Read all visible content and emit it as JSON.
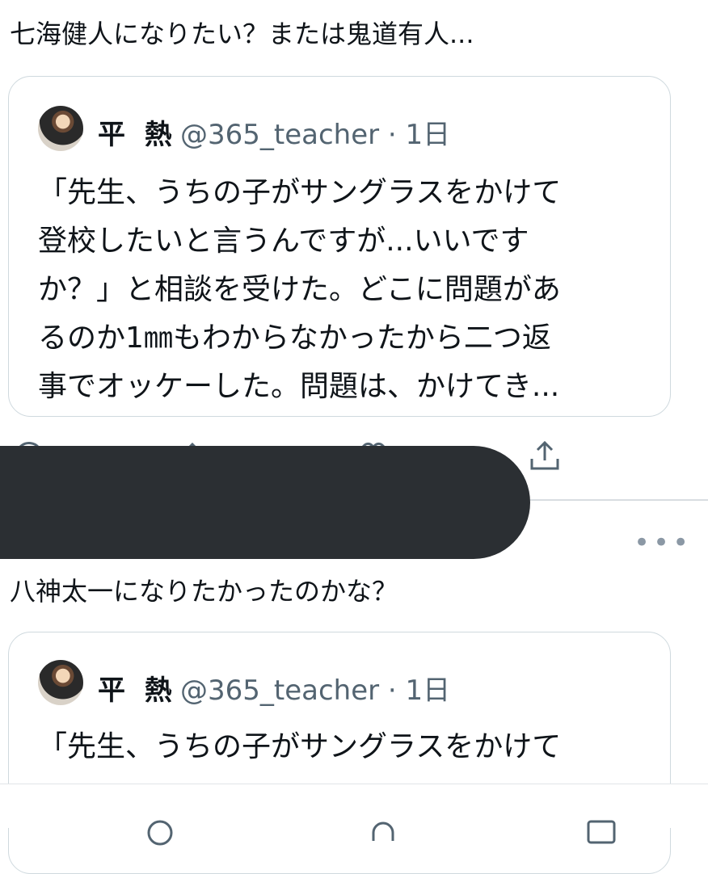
{
  "tweet1": {
    "text": "七海健人になりたい？または鬼道有人..."
  },
  "quote1": {
    "name": "平 熱",
    "handle_time": "@365_teacher · 1日",
    "lines": [
      "「先生、うちの子がサングラスをかけて",
      "登校したいと言うんですが...いいです",
      "か？」と相談を受けた。どこに問題があ",
      "るのか1㎜もわからなかったから二つ返",
      "事でオッケーした。問題は、かけてき..."
    ]
  },
  "tweet2": {
    "text": "八神太一になりたかったのかな？",
    "more": "•••"
  },
  "quote2": {
    "name": "平 熱",
    "handle_time": "@365_teacher · 1日",
    "lines": [
      "「先生、うちの子がサングラスをかけて"
    ]
  },
  "icons": {
    "reply": "reply-icon",
    "retweet": "retweet-icon",
    "like": "like-icon",
    "share": "share-icon",
    "tab_home": "home-icon",
    "tab_search": "search-icon",
    "tab_notifications": "notifications-icon",
    "tab_messages": "messages-icon"
  },
  "colors": {
    "text": "#0f1419",
    "secondary": "#536471",
    "border": "#cfd9de",
    "redaction": "#2b2f33"
  }
}
